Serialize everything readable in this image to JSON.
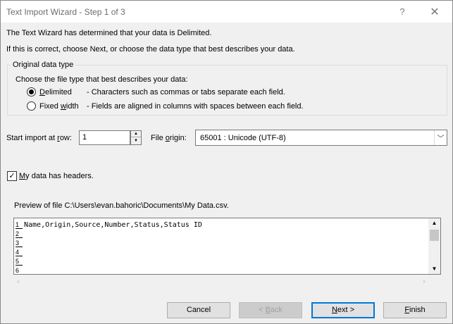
{
  "window": {
    "title": "Text Import Wizard - Step 1 of 3",
    "help_label": "?",
    "close_label": "✕"
  },
  "intro": {
    "line1": "The Text Wizard has determined that your data is Delimited.",
    "line2": "If this is correct, choose Next, or choose the data type that best describes your data."
  },
  "original_data_type": {
    "legend": "Original data type",
    "prompt": "Choose the file type that best describes your data:",
    "options": [
      {
        "label_ul": "D",
        "label_rest": "elimited",
        "description": "- Characters such as commas or tabs separate each field.",
        "selected": true
      },
      {
        "label_pre": "Fixed ",
        "label_ul": "w",
        "label_rest": "idth",
        "description": "- Fields are aligned in columns with spaces between each field.",
        "selected": false
      }
    ]
  },
  "start_row": {
    "label_pre": "Start import at ",
    "label_ul": "r",
    "label_rest": "ow:",
    "value": "1"
  },
  "file_origin": {
    "label_pre": "File ",
    "label_ul": "o",
    "label_rest": "rigin:",
    "value": "65001 : Unicode (UTF-8)"
  },
  "headers": {
    "checked_glyph": "✓",
    "label_ul": "M",
    "label_rest": "y data has headers.",
    "checked": true
  },
  "preview": {
    "label": "Preview of file C:\\Users\\evan.bahoric\\Documents\\My Data.csv.",
    "line_numbers": [
      "1",
      "2",
      "3",
      "4",
      "5",
      "6"
    ],
    "lines": [
      "Name,Origin,Source,Number,Status,Status ID"
    ]
  },
  "icons": {
    "spin_up": "▲",
    "spin_down": "▼",
    "dropdown": "﹀",
    "scroll_up": "▲",
    "scroll_down": "▼",
    "scroll_left": "‹",
    "scroll_right": "›"
  },
  "buttons": {
    "cancel": "Cancel",
    "back_pre": "< ",
    "back_ul": "B",
    "back_rest": "ack",
    "next_ul": "N",
    "next_rest": "ext >",
    "finish_ul": "F",
    "finish_rest": "inish"
  }
}
